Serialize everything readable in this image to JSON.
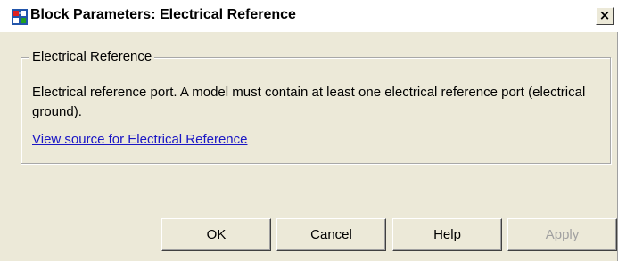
{
  "window": {
    "title": "Block Parameters: Electrical Reference",
    "close_label": "×"
  },
  "group": {
    "legend": "Electrical Reference",
    "description": "Electrical reference port. A model must contain at least one electrical reference port (electrical ground).",
    "link_text": "View source for Electrical Reference"
  },
  "buttons": {
    "ok": "OK",
    "cancel": "Cancel",
    "help": "Help",
    "apply": "Apply",
    "apply_enabled": false
  },
  "colors": {
    "dialog_background": "#ece9d8",
    "link": "#1a16c4",
    "disabled_text": "#a0a0a0"
  },
  "icons": {
    "title_icon": "simulink-block-icon",
    "close_icon": "close-icon"
  }
}
